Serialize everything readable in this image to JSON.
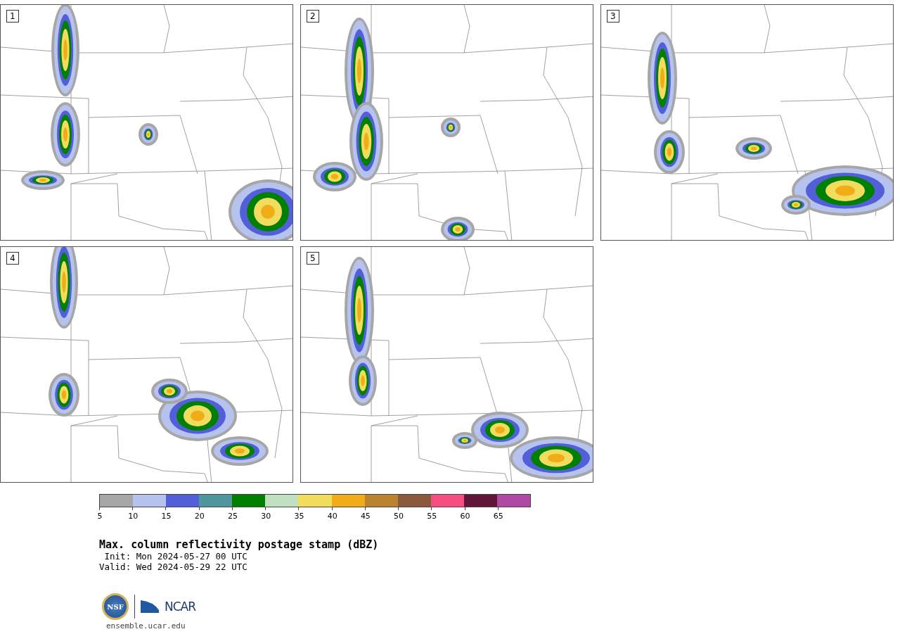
{
  "panels": [
    {
      "label": "1"
    },
    {
      "label": "2"
    },
    {
      "label": "3"
    },
    {
      "label": "4"
    },
    {
      "label": "5"
    }
  ],
  "colorbar": {
    "bins": [
      {
        "color": "#a6a6a6"
      },
      {
        "color": "#b7c3ef"
      },
      {
        "color": "#525fd8"
      },
      {
        "color": "#4f979d"
      },
      {
        "color": "#008000"
      },
      {
        "color": "#bfdfbf"
      },
      {
        "color": "#f1dc5e"
      },
      {
        "color": "#f0ad17"
      },
      {
        "color": "#b9832f"
      },
      {
        "color": "#8a593b"
      },
      {
        "color": "#f54f82"
      },
      {
        "color": "#621637"
      },
      {
        "color": "#ae4aa6"
      }
    ],
    "ticks": [
      "5",
      "10",
      "15",
      "20",
      "25",
      "30",
      "35",
      "40",
      "45",
      "50",
      "55",
      "60",
      "65"
    ]
  },
  "title": "Max. column reflectivity postage stamp (dBZ)",
  "init": " Init: Mon 2024-05-27 00 UTC",
  "valid": "Valid: Wed 2024-05-29 22 UTC",
  "logo": {
    "left": "NSF",
    "right": "NCAR"
  },
  "footer": "ensemble.ucar.edu"
}
